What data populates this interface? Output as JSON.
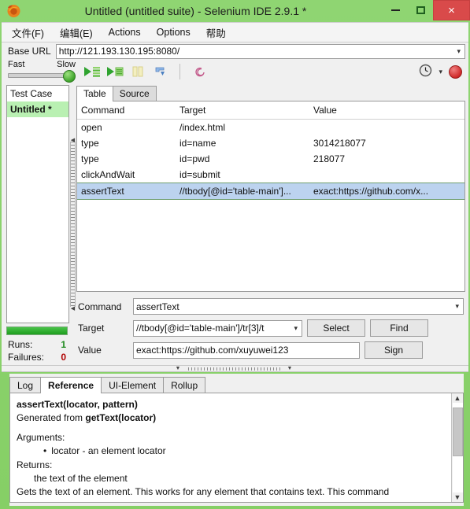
{
  "window": {
    "title": "Untitled (untitled suite) - Selenium IDE 2.9.1 *",
    "app_icon": "firefox-icon",
    "minimize_label": "–",
    "maximize_label": "□",
    "close_label": "×"
  },
  "menubar": {
    "items": [
      {
        "label": "文件(F)",
        "accel": "F"
      },
      {
        "label": "编辑(E)",
        "accel": "E"
      },
      {
        "label": "Actions",
        "accel": "A"
      },
      {
        "label": "Options",
        "accel": "O"
      },
      {
        "label": "帮助",
        "accel": ""
      }
    ]
  },
  "base_url": {
    "label": "Base URL",
    "value": "http://121.193.130.195:8080/",
    "dropdown_icon": "chevron-down-icon"
  },
  "toolbar": {
    "speed_fast_label": "Fast",
    "speed_slow_label": "Slow",
    "buttons": [
      {
        "name": "play-entire-test-suite-button",
        "icon": "play-suite-icon"
      },
      {
        "name": "play-current-test-case-button",
        "icon": "play-test-icon"
      },
      {
        "name": "pause-resume-button",
        "icon": "pause-icon"
      },
      {
        "name": "step-button",
        "icon": "step-icon"
      },
      {
        "name": "rollup-rules-button",
        "icon": "spiral-icon"
      }
    ],
    "clock_icon": "clock-icon",
    "clock_dropdown_icon": "chevron-down-icon",
    "record_icon": "record-button-icon"
  },
  "sidebar": {
    "header": "Test Case",
    "items": [
      {
        "label": "Untitled *",
        "selected": true
      }
    ],
    "runs_label": "Runs:",
    "runs_value": "1",
    "failures_label": "Failures:",
    "failures_value": "0",
    "runs_color": "#1f8a1f",
    "failures_color": "#b00000",
    "progress_color": "#2fb62f"
  },
  "editor_tabs": [
    {
      "label": "Table",
      "active": true
    },
    {
      "label": "Source",
      "active": false
    }
  ],
  "command_table": {
    "columns": [
      "Command",
      "Target",
      "Value"
    ],
    "rows": [
      {
        "command": "open",
        "target": "/index.html",
        "value": "",
        "selected": false
      },
      {
        "command": "type",
        "target": "id=name",
        "value": "3014218077",
        "selected": false
      },
      {
        "command": "type",
        "target": "id=pwd",
        "value": "218077",
        "selected": false
      },
      {
        "command": "clickAndWait",
        "target": "id=submit",
        "value": "",
        "selected": false
      },
      {
        "command": "assertText",
        "target": "//tbody[@id='table-main']...",
        "value": "exact:https://github.com/x...",
        "selected": true
      }
    ],
    "selected_row_color": "#bcd3ef"
  },
  "editor": {
    "command_label": "Command",
    "command_value": "assertText",
    "target_label": "Target",
    "target_value": "//tbody[@id='table-main']/tr[3]/t",
    "value_label": "Value",
    "value_value": "exact:https://github.com/xuyuwei123",
    "select_button": "Select",
    "find_button": "Find",
    "sign_button": "Sign"
  },
  "bottom_panel": {
    "tabs": [
      {
        "label": "Log",
        "active": false
      },
      {
        "label": "Reference",
        "active": true
      },
      {
        "label": "UI-Element",
        "active": false
      },
      {
        "label": "Rollup",
        "active": false
      }
    ],
    "reference": {
      "signature": "assertText(locator, pattern)",
      "generated_prefix": "Generated from ",
      "generated_from": "getText(locator)",
      "arguments_label": "Arguments:",
      "argument_item": "locator - an element locator",
      "returns_label": "Returns:",
      "returns_item": "the text of the element",
      "description": "Gets the text of an element. This works for any element that contains text. This command"
    },
    "scroll_up_icon": "chevron-up-icon",
    "scroll_down_icon": "chevron-down-icon"
  }
}
